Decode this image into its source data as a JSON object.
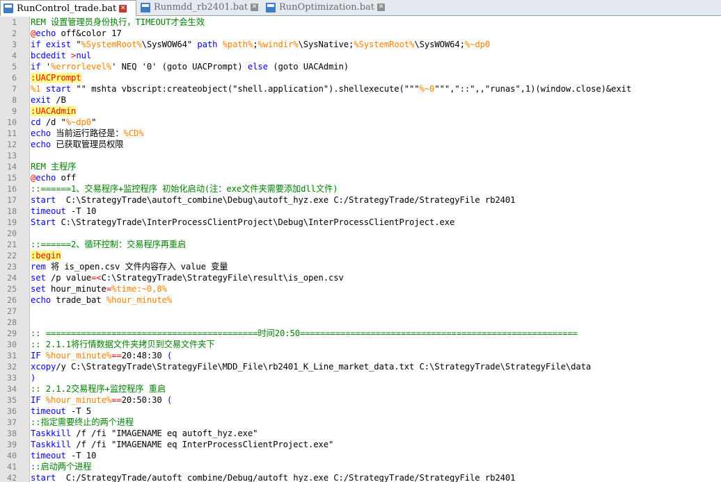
{
  "tabs": [
    {
      "label": "RunControl_trade.bat",
      "active": true
    },
    {
      "label": "Runmdd_rb2401.bat",
      "active": false
    },
    {
      "label": "RunOptimization.bat",
      "active": false
    }
  ],
  "colors": {
    "comment": "#008000",
    "keyword": "#0000ff",
    "variable": "#ff8000",
    "label": "#ff0000",
    "label_bg": "#ffff80"
  },
  "lines": [
    [
      [
        "c",
        "REM 设置管理员身份执行，TIMEOUT才会生效"
      ]
    ],
    [
      [
        "a",
        "@"
      ],
      [
        "k",
        "echo"
      ],
      [
        "n",
        " off&color 17"
      ]
    ],
    [
      [
        "k",
        "if exist"
      ],
      [
        "n",
        " \""
      ],
      [
        "v",
        "%SystemRoot%"
      ],
      [
        "n",
        "\\SysWOW64\" "
      ],
      [
        "k",
        "path"
      ],
      [
        "n",
        " "
      ],
      [
        "v",
        "%path%"
      ],
      [
        "n",
        ";"
      ],
      [
        "v",
        "%windir%"
      ],
      [
        "n",
        "\\SysNative;"
      ],
      [
        "v",
        "%SystemRoot%"
      ],
      [
        "n",
        "\\SysWOW64;"
      ],
      [
        "v",
        "%~dp0"
      ]
    ],
    [
      [
        "k",
        "bcdedit"
      ],
      [
        "n",
        " "
      ],
      [
        "o",
        ">"
      ],
      [
        "k",
        "nul"
      ]
    ],
    [
      [
        "k",
        "if"
      ],
      [
        "n",
        " '"
      ],
      [
        "v",
        "%errorlevel%"
      ],
      [
        "n",
        "' NEQ '0' (goto UACPrompt) "
      ],
      [
        "k",
        "else"
      ],
      [
        "n",
        " (goto UACAdmin)"
      ]
    ],
    [
      [
        "l",
        ":UACPrompt"
      ]
    ],
    [
      [
        "v",
        "%1"
      ],
      [
        "n",
        " "
      ],
      [
        "k",
        "start"
      ],
      [
        "n",
        " \"\" mshta vbscript:createobject(\"shell.application\").shellexecute(\"\"\""
      ],
      [
        "v",
        "%~0"
      ],
      [
        "n",
        "\"\"\",\"::\",,\"runas\",1)(window.close)&exit"
      ]
    ],
    [
      [
        "k",
        "exit"
      ],
      [
        "n",
        " /B"
      ]
    ],
    [
      [
        "l",
        ":UACAdmin"
      ]
    ],
    [
      [
        "k",
        "cd"
      ],
      [
        "n",
        " /d \""
      ],
      [
        "v",
        "%~dp0"
      ],
      [
        "n",
        "\""
      ]
    ],
    [
      [
        "k",
        "echo"
      ],
      [
        "n",
        " 当前运行路径是："
      ],
      [
        "v",
        "%CD%"
      ]
    ],
    [
      [
        "k",
        "echo"
      ],
      [
        "n",
        " 已获取管理员权限"
      ]
    ],
    [],
    [
      [
        "c",
        "REM 主程序"
      ]
    ],
    [
      [
        "a",
        "@"
      ],
      [
        "k",
        "echo"
      ],
      [
        "n",
        " off"
      ]
    ],
    [
      [
        "c",
        "::======1、交易程序+监控程序 初始化启动(注：exe文件夹需要添加dll文件)"
      ]
    ],
    [
      [
        "k",
        "start"
      ],
      [
        "n",
        "  C:\\StrategyTrade\\autoft_combine\\Debug\\autoft_hyz.exe C:/StrategyTrade/StrategyFile rb2401"
      ]
    ],
    [
      [
        "k",
        "timeout"
      ],
      [
        "n",
        " -T 10"
      ]
    ],
    [
      [
        "k",
        "Start"
      ],
      [
        "n",
        " C:\\StrategyTrade\\InterProcessClientProject\\Debug\\InterProcessClientProject.exe"
      ]
    ],
    [],
    [
      [
        "c",
        "::======2、循环控制：交易程序再重启"
      ]
    ],
    [
      [
        "l",
        ":begin"
      ]
    ],
    [
      [
        "k",
        "rem"
      ],
      [
        "n",
        " 将 is_open.csv 文件内容存入 value 变量"
      ]
    ],
    [
      [
        "k",
        "set"
      ],
      [
        "n",
        " /p value"
      ],
      [
        "o",
        "=<"
      ],
      [
        "n",
        "C:\\StrategyTrade\\StrategyFile\\result\\is_open.csv"
      ]
    ],
    [
      [
        "k",
        "set"
      ],
      [
        "n",
        " hour_minute"
      ],
      [
        "o",
        "="
      ],
      [
        "v",
        "%time:~0,8%"
      ]
    ],
    [
      [
        "k",
        "echo"
      ],
      [
        "n",
        " trade_bat "
      ],
      [
        "v",
        "%hour_minute%"
      ]
    ],
    [],
    [],
    [
      [
        "c",
        ":: ==========================================时间20:50======================================================="
      ]
    ],
    [
      [
        "c",
        ":: 2.1.1将行情数据文件夹拷贝到交易文件夹下"
      ]
    ],
    [
      [
        "k",
        "IF"
      ],
      [
        "n",
        " "
      ],
      [
        "v",
        "%hour_minute%"
      ],
      [
        "o",
        "=="
      ],
      [
        "n",
        "20:48:30 "
      ],
      [
        "k",
        "("
      ]
    ],
    [
      [
        "k",
        "xcopy"
      ],
      [
        "n",
        "/y C:\\StrategyTrade\\StrategyFile\\MDD_File\\rb2401_K_Line_market_data.txt C:\\StrategyTrade\\StrategyFile\\data"
      ]
    ],
    [
      [
        "k",
        ")"
      ]
    ],
    [
      [
        "c",
        ":: 2.1.2交易程序+监控程序 重启"
      ]
    ],
    [
      [
        "k",
        "IF"
      ],
      [
        "n",
        " "
      ],
      [
        "v",
        "%hour_minute%"
      ],
      [
        "o",
        "=="
      ],
      [
        "n",
        "20:50:30 "
      ],
      [
        "k",
        "("
      ]
    ],
    [
      [
        "k",
        "timeout"
      ],
      [
        "n",
        " -T 5"
      ]
    ],
    [
      [
        "c",
        "::指定需要终止的两个进程"
      ]
    ],
    [
      [
        "k",
        "Taskkill"
      ],
      [
        "n",
        " /f /fi \"IMAGENAME eq autoft_hyz.exe\""
      ]
    ],
    [
      [
        "k",
        "Taskkill"
      ],
      [
        "n",
        " /f /fi \"IMAGENAME eq InterProcessClientProject.exe\""
      ]
    ],
    [
      [
        "k",
        "timeout"
      ],
      [
        "n",
        " -T 10"
      ]
    ],
    [
      [
        "c",
        "::启动两个进程"
      ]
    ],
    [
      [
        "k",
        "start"
      ],
      [
        "n",
        "  C:/StrategyTrade/autoft_combine/Debug/autoft_hyz.exe C:/StrategyTrade/StrategyFile rb2401"
      ]
    ]
  ]
}
